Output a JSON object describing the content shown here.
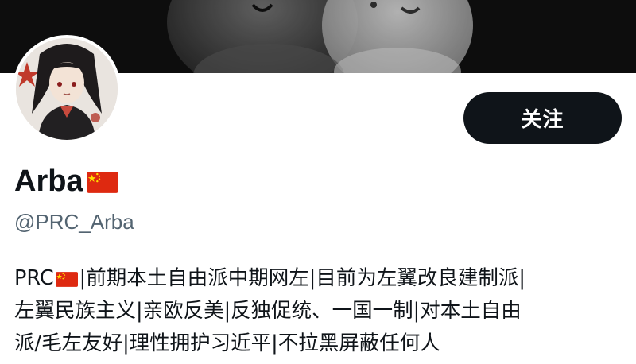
{
  "profile": {
    "display_name": "Arba",
    "handle": "@PRC_Arba",
    "follow_label": "关注",
    "bio_lead": "PRC",
    "bio_line1_rest": "|前期本土自由派中期网左|目前为左翼改良建制派|",
    "bio_line2": "左翼民族主义|亲欧反美|反独促统、一国一制|对本土自由",
    "bio_line3": "派/毛左友好|理性拥护习近平|不拉黑屏蔽任何人"
  },
  "icons": {
    "name_flag": "china-flag-icon",
    "bio_flag": "china-flag-icon"
  },
  "colors": {
    "follow_bg": "#0f1419",
    "handle": "#536471",
    "flag_red": "#de2910",
    "flag_star": "#ffde00"
  }
}
